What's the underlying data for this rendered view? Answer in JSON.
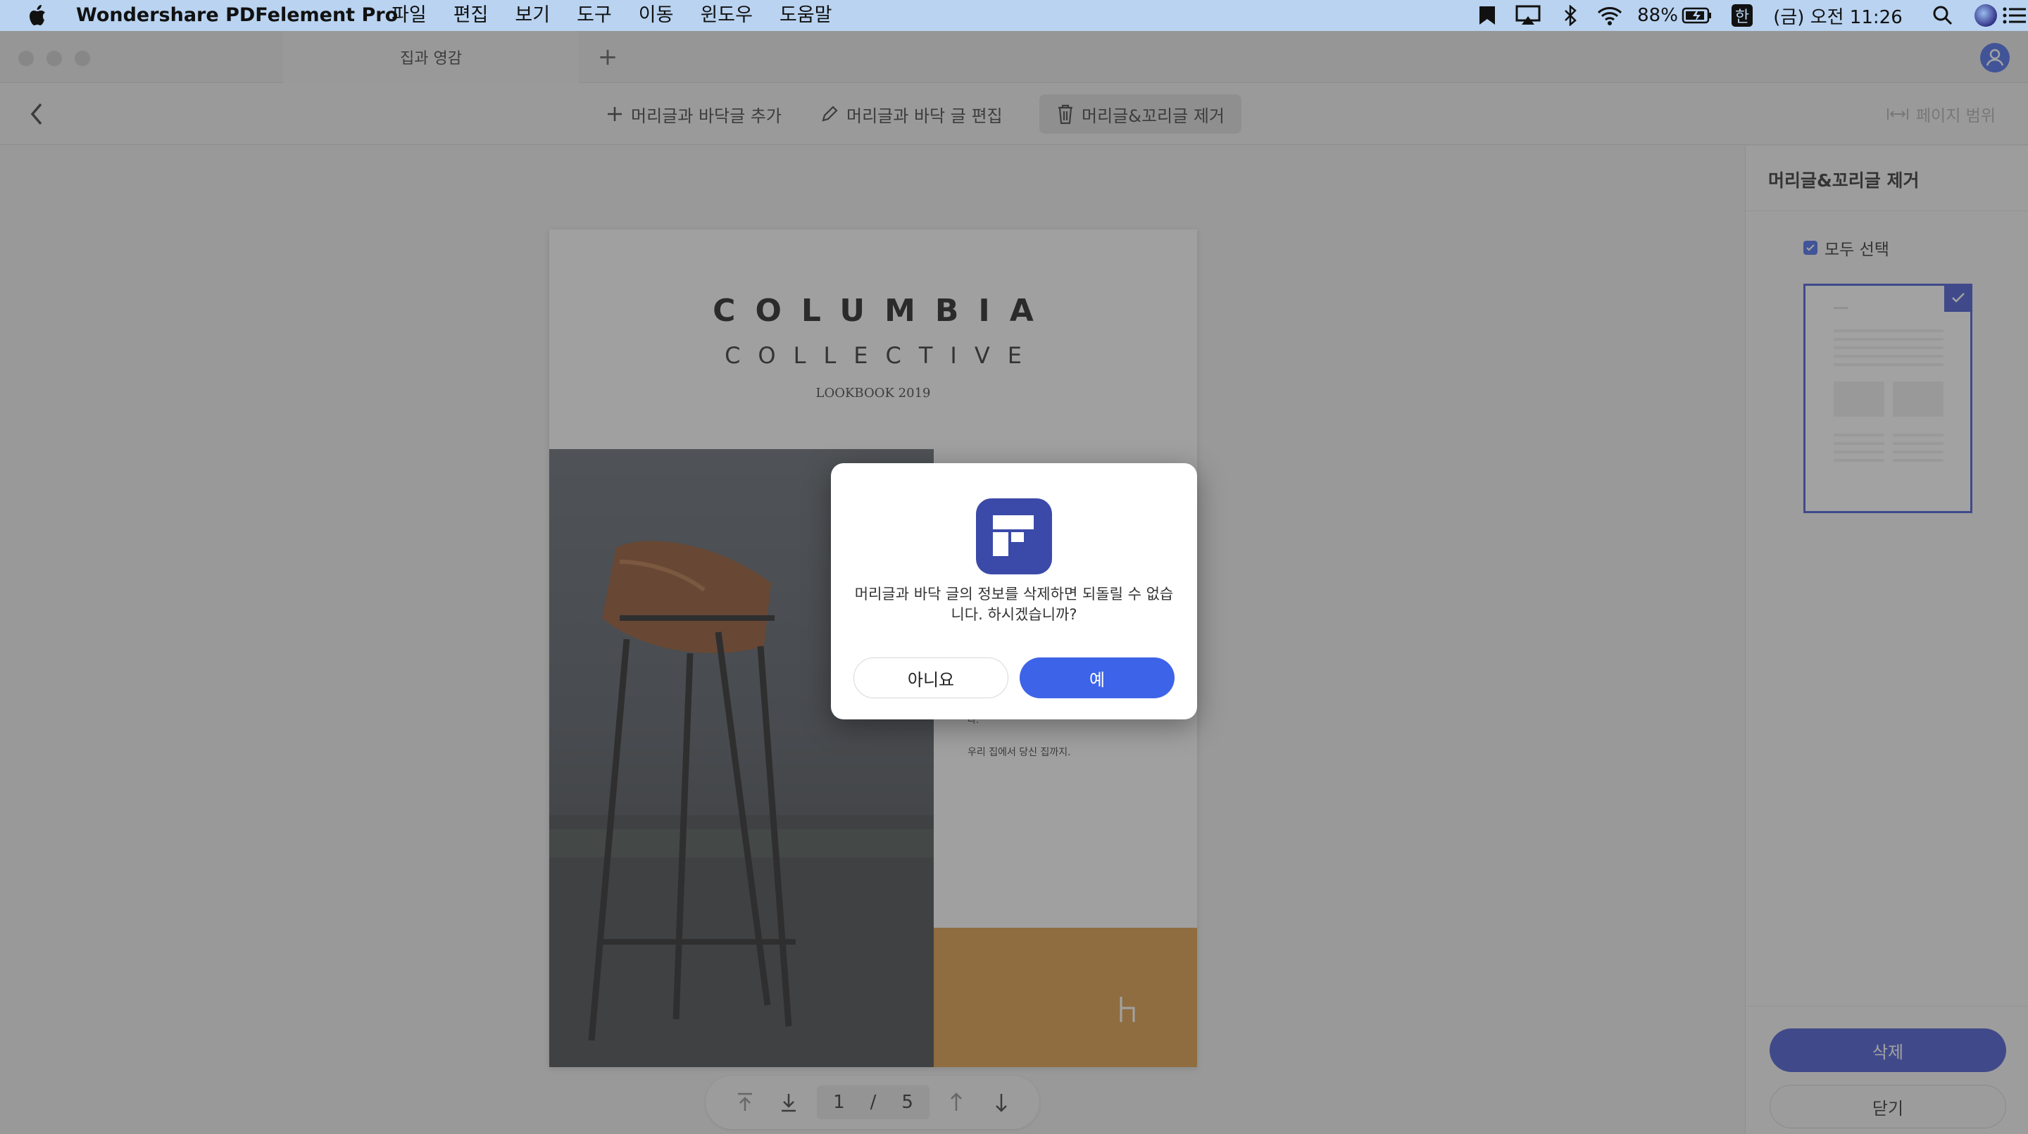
{
  "menubar": {
    "app_name": "Wondershare PDFelement Pro",
    "menus": [
      "파일",
      "편집",
      "보기",
      "도구",
      "이동",
      "윈도우",
      "도움말"
    ],
    "battery": "88%",
    "input_method": "한",
    "clock": "(금) 오전 11:26"
  },
  "window": {
    "tab_title": "집과 영감"
  },
  "toolbar": {
    "add_label": "머리글과 바닥글 추가",
    "edit_label": "머리글과 바닥 글 편집",
    "remove_label": "머리글&꼬리글 제거",
    "page_range_label": "페이지 범위"
  },
  "document": {
    "title": "COLUMBIA",
    "subtitle": "COLLECTIVE",
    "lookbook": "LOOKBOOK 2019",
    "body_line1": "다.",
    "body_line2": "우리 집에서 당신 집까지."
  },
  "pager": {
    "current": "1",
    "separator": "/",
    "total": "5"
  },
  "panel": {
    "title": "머리글&꼬리글 제거",
    "select_all_label": "모두 선택",
    "delete_label": "삭제",
    "close_label": "닫기"
  },
  "dialog": {
    "message_line1": "머리글과 바닥 글의 정보를 삭제하면 되돌릴 수 없습",
    "message_line2": "니다. 하시겠습니까?",
    "no_label": "아니요",
    "yes_label": "예"
  },
  "colors": {
    "accent": "#3d63e8",
    "panel_accent": "#3b4fcf",
    "menubar": "#b9d3f0"
  }
}
